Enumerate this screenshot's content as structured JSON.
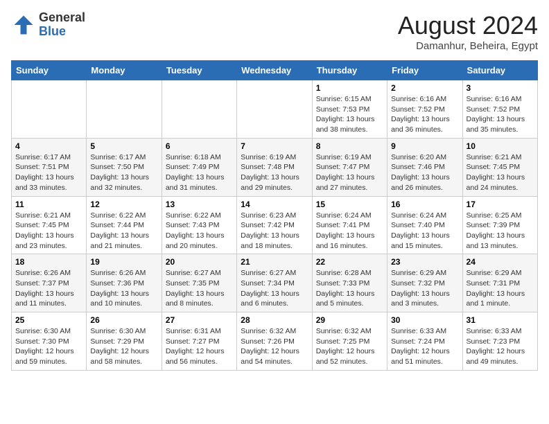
{
  "header": {
    "logo_general": "General",
    "logo_blue": "Blue",
    "month_title": "August 2024",
    "location": "Damanhur, Beheira, Egypt"
  },
  "weekdays": [
    "Sunday",
    "Monday",
    "Tuesday",
    "Wednesday",
    "Thursday",
    "Friday",
    "Saturday"
  ],
  "weeks": [
    [
      {
        "day": "",
        "info": ""
      },
      {
        "day": "",
        "info": ""
      },
      {
        "day": "",
        "info": ""
      },
      {
        "day": "",
        "info": ""
      },
      {
        "day": "1",
        "info": "Sunrise: 6:15 AM\nSunset: 7:53 PM\nDaylight: 13 hours\nand 38 minutes."
      },
      {
        "day": "2",
        "info": "Sunrise: 6:16 AM\nSunset: 7:52 PM\nDaylight: 13 hours\nand 36 minutes."
      },
      {
        "day": "3",
        "info": "Sunrise: 6:16 AM\nSunset: 7:52 PM\nDaylight: 13 hours\nand 35 minutes."
      }
    ],
    [
      {
        "day": "4",
        "info": "Sunrise: 6:17 AM\nSunset: 7:51 PM\nDaylight: 13 hours\nand 33 minutes."
      },
      {
        "day": "5",
        "info": "Sunrise: 6:17 AM\nSunset: 7:50 PM\nDaylight: 13 hours\nand 32 minutes."
      },
      {
        "day": "6",
        "info": "Sunrise: 6:18 AM\nSunset: 7:49 PM\nDaylight: 13 hours\nand 31 minutes."
      },
      {
        "day": "7",
        "info": "Sunrise: 6:19 AM\nSunset: 7:48 PM\nDaylight: 13 hours\nand 29 minutes."
      },
      {
        "day": "8",
        "info": "Sunrise: 6:19 AM\nSunset: 7:47 PM\nDaylight: 13 hours\nand 27 minutes."
      },
      {
        "day": "9",
        "info": "Sunrise: 6:20 AM\nSunset: 7:46 PM\nDaylight: 13 hours\nand 26 minutes."
      },
      {
        "day": "10",
        "info": "Sunrise: 6:21 AM\nSunset: 7:45 PM\nDaylight: 13 hours\nand 24 minutes."
      }
    ],
    [
      {
        "day": "11",
        "info": "Sunrise: 6:21 AM\nSunset: 7:45 PM\nDaylight: 13 hours\nand 23 minutes."
      },
      {
        "day": "12",
        "info": "Sunrise: 6:22 AM\nSunset: 7:44 PM\nDaylight: 13 hours\nand 21 minutes."
      },
      {
        "day": "13",
        "info": "Sunrise: 6:22 AM\nSunset: 7:43 PM\nDaylight: 13 hours\nand 20 minutes."
      },
      {
        "day": "14",
        "info": "Sunrise: 6:23 AM\nSunset: 7:42 PM\nDaylight: 13 hours\nand 18 minutes."
      },
      {
        "day": "15",
        "info": "Sunrise: 6:24 AM\nSunset: 7:41 PM\nDaylight: 13 hours\nand 16 minutes."
      },
      {
        "day": "16",
        "info": "Sunrise: 6:24 AM\nSunset: 7:40 PM\nDaylight: 13 hours\nand 15 minutes."
      },
      {
        "day": "17",
        "info": "Sunrise: 6:25 AM\nSunset: 7:39 PM\nDaylight: 13 hours\nand 13 minutes."
      }
    ],
    [
      {
        "day": "18",
        "info": "Sunrise: 6:26 AM\nSunset: 7:37 PM\nDaylight: 13 hours\nand 11 minutes."
      },
      {
        "day": "19",
        "info": "Sunrise: 6:26 AM\nSunset: 7:36 PM\nDaylight: 13 hours\nand 10 minutes."
      },
      {
        "day": "20",
        "info": "Sunrise: 6:27 AM\nSunset: 7:35 PM\nDaylight: 13 hours\nand 8 minutes."
      },
      {
        "day": "21",
        "info": "Sunrise: 6:27 AM\nSunset: 7:34 PM\nDaylight: 13 hours\nand 6 minutes."
      },
      {
        "day": "22",
        "info": "Sunrise: 6:28 AM\nSunset: 7:33 PM\nDaylight: 13 hours\nand 5 minutes."
      },
      {
        "day": "23",
        "info": "Sunrise: 6:29 AM\nSunset: 7:32 PM\nDaylight: 13 hours\nand 3 minutes."
      },
      {
        "day": "24",
        "info": "Sunrise: 6:29 AM\nSunset: 7:31 PM\nDaylight: 13 hours\nand 1 minute."
      }
    ],
    [
      {
        "day": "25",
        "info": "Sunrise: 6:30 AM\nSunset: 7:30 PM\nDaylight: 12 hours\nand 59 minutes."
      },
      {
        "day": "26",
        "info": "Sunrise: 6:30 AM\nSunset: 7:29 PM\nDaylight: 12 hours\nand 58 minutes."
      },
      {
        "day": "27",
        "info": "Sunrise: 6:31 AM\nSunset: 7:27 PM\nDaylight: 12 hours\nand 56 minutes."
      },
      {
        "day": "28",
        "info": "Sunrise: 6:32 AM\nSunset: 7:26 PM\nDaylight: 12 hours\nand 54 minutes."
      },
      {
        "day": "29",
        "info": "Sunrise: 6:32 AM\nSunset: 7:25 PM\nDaylight: 12 hours\nand 52 minutes."
      },
      {
        "day": "30",
        "info": "Sunrise: 6:33 AM\nSunset: 7:24 PM\nDaylight: 12 hours\nand 51 minutes."
      },
      {
        "day": "31",
        "info": "Sunrise: 6:33 AM\nSunset: 7:23 PM\nDaylight: 12 hours\nand 49 minutes."
      }
    ]
  ]
}
